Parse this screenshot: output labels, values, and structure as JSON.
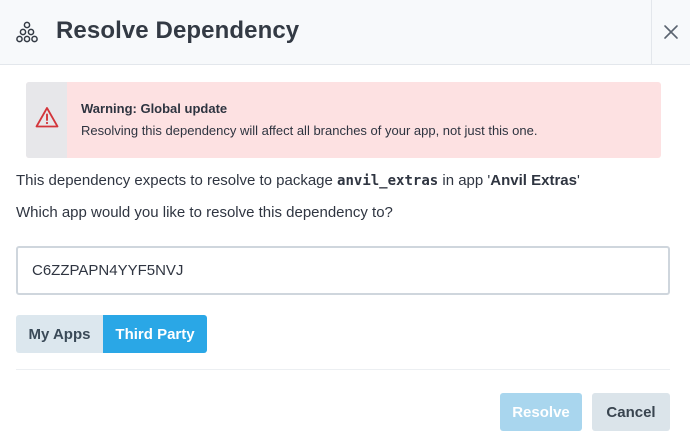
{
  "dialog": {
    "title": "Resolve Dependency",
    "icon": "dependency-tree-icon",
    "close_icon": "close-icon"
  },
  "warning": {
    "icon": "warning-triangle-icon",
    "title": "Warning: Global update",
    "message": "Resolving this dependency will affect all branches of your app, not just this one.",
    "background_color": "#fde1e2",
    "icon_color": "#d3353b"
  },
  "body": {
    "line1_prefix": "This dependency expects to resolve to package ",
    "package_name": "anvil_extras",
    "line1_middle": " in app '",
    "app_name": "Anvil Extras",
    "line1_suffix": "'",
    "question": "Which app would you like to resolve this dependency to?"
  },
  "app_input": {
    "value": "C6ZZPAPN4YYF5NVJ"
  },
  "source_toggle": {
    "options": [
      "My Apps",
      "Third Party"
    ],
    "selected": "Third Party",
    "active_color": "#2aa7e6"
  },
  "footer": {
    "resolve_label": "Resolve",
    "cancel_label": "Cancel"
  }
}
